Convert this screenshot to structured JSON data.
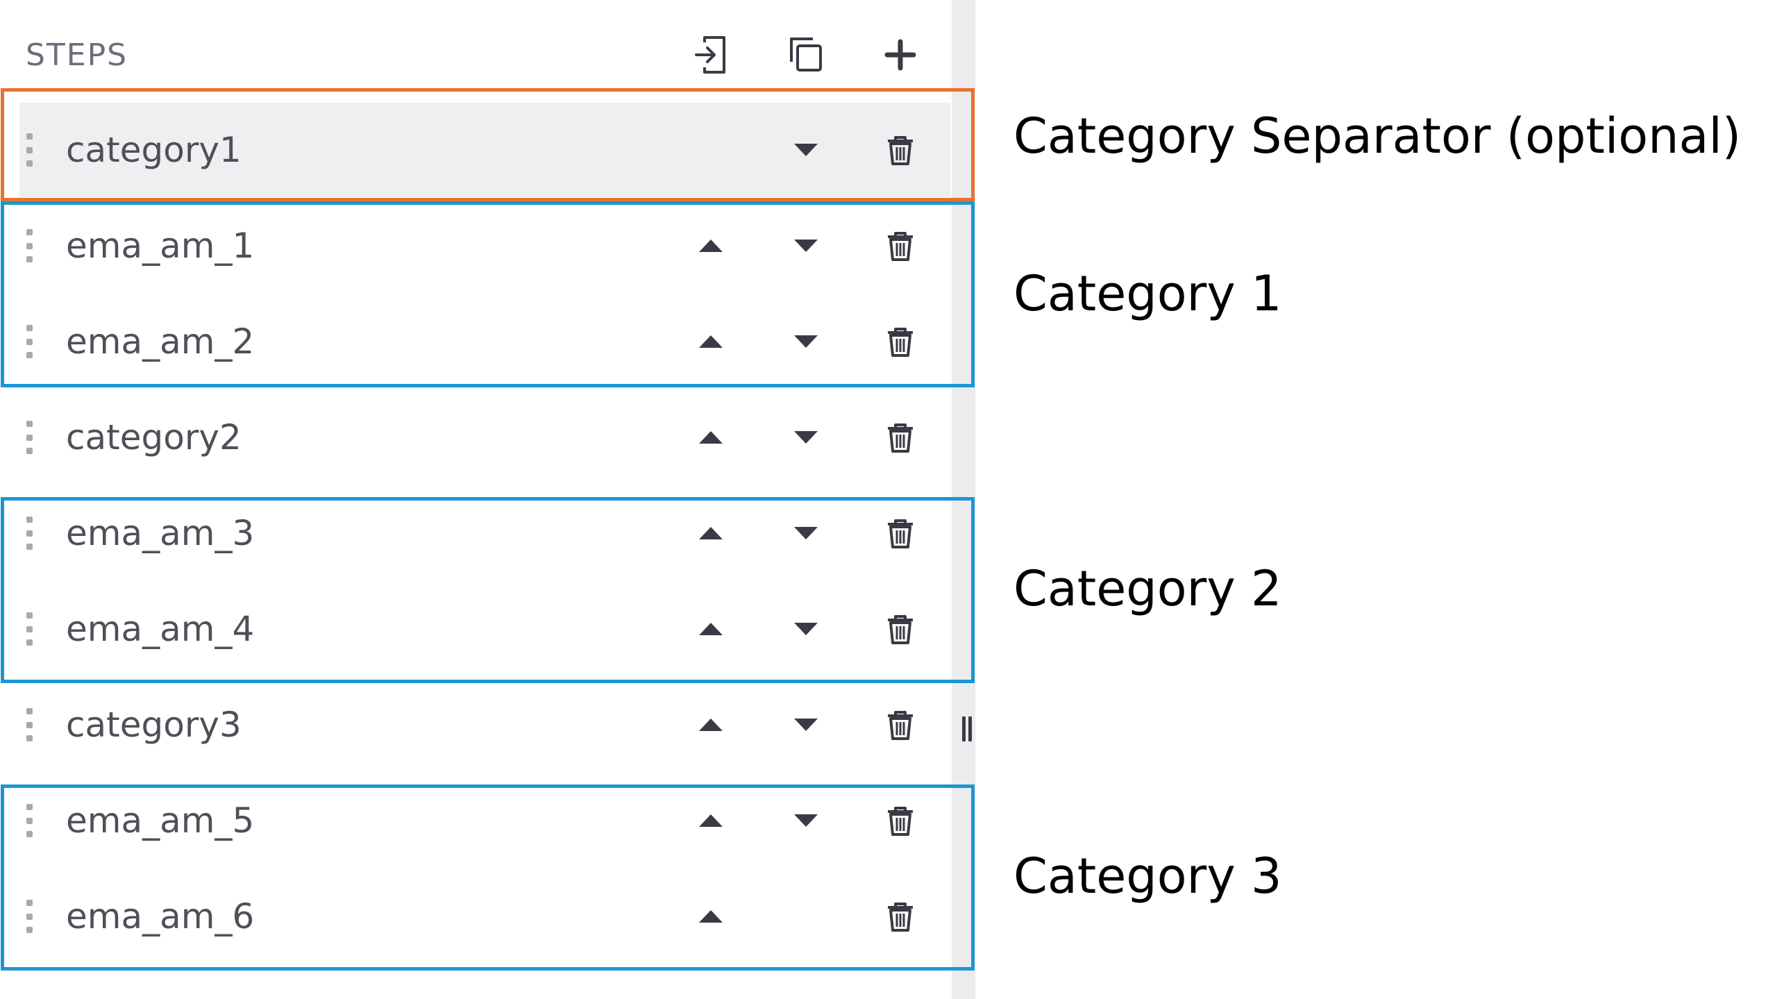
{
  "panel": {
    "title": "STEPS",
    "header_icons": [
      "import-icon",
      "duplicate-icon",
      "add-icon"
    ],
    "rows": [
      {
        "label": "category1",
        "selected": true,
        "has_up": false,
        "has_down": true
      },
      {
        "label": "ema_am_1",
        "selected": false,
        "has_up": true,
        "has_down": true
      },
      {
        "label": "ema_am_2",
        "selected": false,
        "has_up": true,
        "has_down": true
      },
      {
        "label": "category2",
        "selected": false,
        "has_up": true,
        "has_down": true
      },
      {
        "label": "ema_am_3",
        "selected": false,
        "has_up": true,
        "has_down": true
      },
      {
        "label": "ema_am_4",
        "selected": false,
        "has_up": true,
        "has_down": true
      },
      {
        "label": "category3",
        "selected": false,
        "has_up": true,
        "has_down": true
      },
      {
        "label": "ema_am_5",
        "selected": false,
        "has_up": true,
        "has_down": true
      },
      {
        "label": "ema_am_6",
        "selected": false,
        "has_up": true,
        "has_down": false
      }
    ]
  },
  "annotations": {
    "separator": "Category Separator (optional)",
    "category1": "Category 1",
    "category2": "Category 2",
    "category3": "Category 3"
  },
  "colors": {
    "separator_box": "#e8722f",
    "category_box": "#1a97d2",
    "selected_row": "#efeff1",
    "icon": "#3a3a44"
  }
}
